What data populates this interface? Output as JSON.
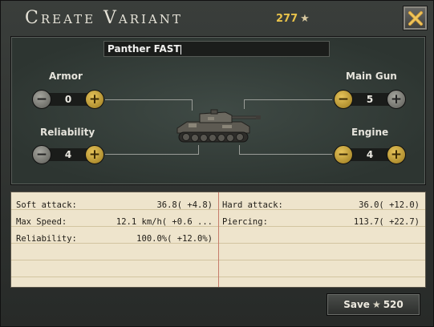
{
  "dialog": {
    "title": "Create Variant",
    "cost": "277",
    "cost_icon": "star-icon",
    "close_icon": "close-x-icon"
  },
  "name_field": {
    "value": "Panther FAST"
  },
  "modules": {
    "armor": {
      "label": "Armor",
      "value": "0"
    },
    "reliability": {
      "label": "Reliability",
      "value": "4"
    },
    "main_gun": {
      "label": "Main Gun",
      "value": "5"
    },
    "engine": {
      "label": "Engine",
      "value": "4"
    }
  },
  "stats": {
    "left": [
      {
        "label": "Soft attack:",
        "value": "36.8( +4.8)"
      },
      {
        "label": "Max Speed:",
        "value": "12.1 km/h( +0.6 ..."
      },
      {
        "label": "Reliability:",
        "value": "100.0%( +12.0%)"
      }
    ],
    "right": [
      {
        "label": "Hard attack:",
        "value": "36.0( +12.0)"
      },
      {
        "label": "Piercing:",
        "value": "113.7( +22.7)"
      }
    ]
  },
  "save_button": {
    "label": "Save",
    "cost": "520",
    "icon": "star-icon"
  },
  "colors": {
    "cost_gold": "#e8c24a",
    "panel_green": "#3f4a45",
    "paper": "#eee4cc",
    "plus_gold": "#d4a93a"
  }
}
